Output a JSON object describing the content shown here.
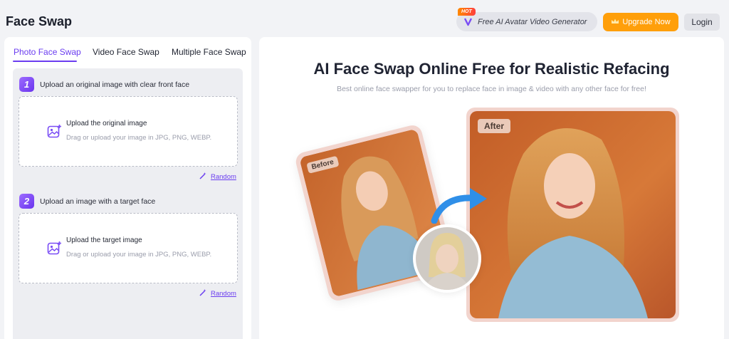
{
  "app": {
    "title": "Face Swap"
  },
  "header": {
    "promo_badge": "HOT",
    "promo_label": "Free AI Avatar Video Generator",
    "upgrade_label": "Upgrade Now",
    "login_label": "Login"
  },
  "tabs": [
    {
      "label": "Photo Face Swap",
      "active": true
    },
    {
      "label": "Video Face Swap",
      "active": false
    },
    {
      "label": "Multiple Face Swap",
      "active": false
    }
  ],
  "steps": [
    {
      "number": "1",
      "label": "Upload an original image with clear front face",
      "upload_title": "Upload the original image",
      "upload_hint": "Drag or upload your image in JPG, PNG, WEBP.",
      "random_label": "Random"
    },
    {
      "number": "2",
      "label": "Upload an image with a target face",
      "upload_title": "Upload the target image",
      "upload_hint": "Drag or upload your image in JPG, PNG, WEBP.",
      "random_label": "Random"
    }
  ],
  "hero": {
    "title": "AI Face Swap Online Free for Realistic Refacing",
    "subtitle": "Best online face swapper for you to replace face in image & video with any other face for free!",
    "before_label": "Before",
    "after_label": "After"
  },
  "colors": {
    "accent": "#6b3df0",
    "upgrade": "#ff9f0a",
    "photo_bg": "#d36a2f"
  },
  "icons": {
    "promo": "ai-avatar-logo-icon",
    "upgrade": "crown-icon",
    "upload": "add-image-icon",
    "random": "magic-wand-icon",
    "arrow": "curved-arrow-icon"
  }
}
